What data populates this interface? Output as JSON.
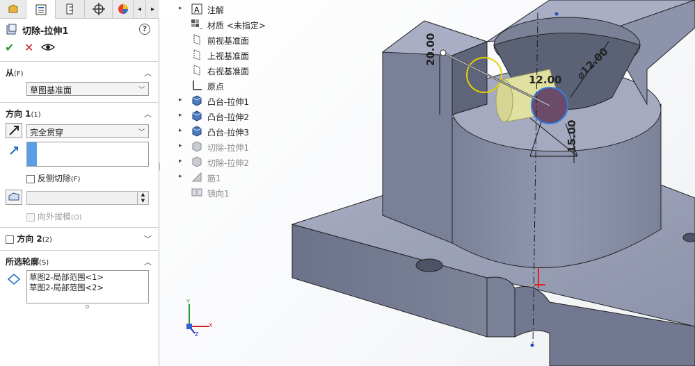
{
  "tabs": [
    "feature-manager",
    "property-manager",
    "config-manager",
    "dim-expert",
    "appearance"
  ],
  "panel": {
    "title": "切除-拉伸1",
    "ok": "✔",
    "cancel": "✕"
  },
  "from": {
    "header": "从",
    "shortcut": "(F)",
    "value": "草图基准面"
  },
  "direction1": {
    "header": "方向 1",
    "shortcut": "(1)",
    "end_condition": "完全贯穿",
    "flip_side_label": "反侧切除",
    "flip_side_shortcut": "(F)",
    "draft_label": "向外拔模",
    "draft_shortcut": "(O)"
  },
  "direction2": {
    "header": "方向 2",
    "shortcut": "(2)"
  },
  "selected_contours": {
    "header": "所选轮廓",
    "shortcut": "(S)",
    "items": [
      "草图2-局部范围<1>",
      "草图2-局部范围<2>"
    ]
  },
  "tree": {
    "items": [
      {
        "label": "注解",
        "icon": "annotations-icon",
        "dim": false,
        "arrow": true
      },
      {
        "label": "材质 <未指定>",
        "icon": "material-icon",
        "dim": false,
        "arrow": false
      },
      {
        "label": "前视基准面",
        "icon": "plane-icon",
        "dim": false,
        "arrow": false
      },
      {
        "label": "上视基准面",
        "icon": "plane-icon",
        "dim": false,
        "arrow": false
      },
      {
        "label": "右视基准面",
        "icon": "plane-icon",
        "dim": false,
        "arrow": false
      },
      {
        "label": "原点",
        "icon": "origin-icon",
        "dim": false,
        "arrow": false
      },
      {
        "label": "凸台-拉伸1",
        "icon": "boss-extrude-icon",
        "dim": false,
        "arrow": true
      },
      {
        "label": "凸台-拉伸2",
        "icon": "boss-extrude-icon",
        "dim": false,
        "arrow": true
      },
      {
        "label": "凸台-拉伸3",
        "icon": "boss-extrude-icon",
        "dim": false,
        "arrow": true
      },
      {
        "label": "切除-拉伸1",
        "icon": "cut-extrude-icon",
        "dim": true,
        "arrow": true
      },
      {
        "label": "切除-拉伸2",
        "icon": "cut-extrude-icon",
        "dim": true,
        "arrow": true
      },
      {
        "label": "筋1",
        "icon": "rib-icon",
        "dim": true,
        "arrow": true
      },
      {
        "label": "镜向1",
        "icon": "mirror-icon",
        "dim": true,
        "arrow": false
      }
    ]
  },
  "dimensions": {
    "d1": "20.00",
    "d2": "12.00",
    "d3": "⌀12.00",
    "d4": "15.00"
  },
  "triad": {
    "x": "X",
    "y": "Y",
    "z": "Z"
  },
  "colors": {
    "accent": "#1e6fc0",
    "part": "#8c92a8",
    "partDark": "#6f7589",
    "partLight": "#a7adc2",
    "sketch": "#1a1a1a",
    "preview": "#e0e0a0"
  }
}
